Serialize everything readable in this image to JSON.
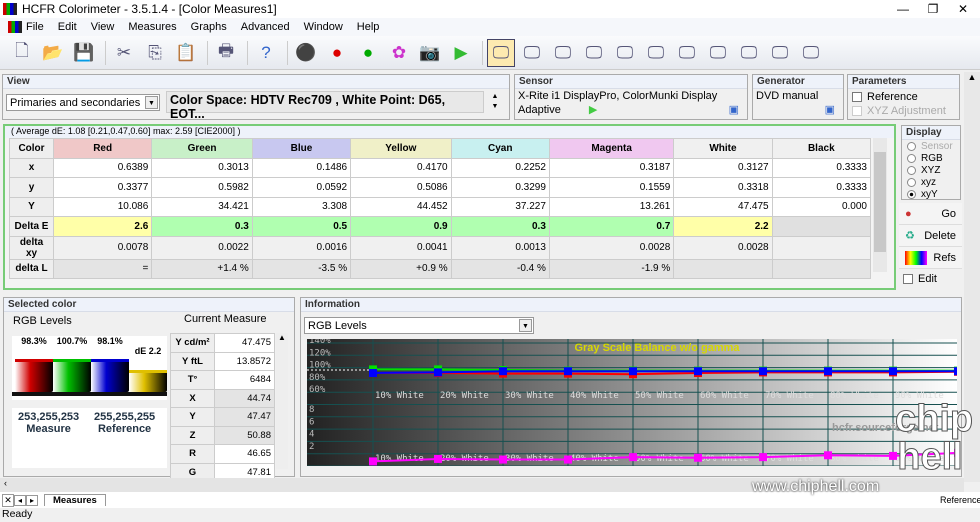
{
  "window": {
    "title": "HCFR Colorimeter - 3.5.1.4 - [Color Measures1]"
  },
  "menu": [
    "File",
    "Edit",
    "View",
    "Measures",
    "Graphs",
    "Advanced",
    "Window",
    "Help"
  ],
  "toolbar": [
    "new-icon",
    "open-icon",
    "save-icon",
    "cut-icon",
    "copy-icon",
    "paste-icon",
    "print-icon",
    "help-icon",
    "gray-scale-icon",
    "primaries-icon",
    "secondaries-icon",
    "saturation-icon",
    "camera-icon",
    "play-icon",
    "measures-view-icon",
    "graph-1-icon",
    "graph-2-icon",
    "graph-3-icon",
    "graph-4-icon",
    "graph-5-icon",
    "graph-6-icon",
    "graph-7-icon",
    "graph-8-icon",
    "graph-9-icon",
    "graph-10-icon"
  ],
  "view": {
    "label": "View",
    "mode": "Primaries and secondaries",
    "colorspace": "Color Space: HDTV Rec709 , White Point: D65, EOT..."
  },
  "sensor": {
    "label": "Sensor",
    "name": "X-Rite i1 DisplayPro, ColorMunki Display",
    "mode": "Adaptive"
  },
  "generator": {
    "label": "Generator",
    "name": "DVD manual"
  },
  "parameters": {
    "label": "Parameters",
    "reference": "Reference",
    "xyz_adjustment": "XYZ Adjustment"
  },
  "table": {
    "summary": "( Average dE: 1.08 [0.21,0.47,0.60] max: 2.59 [CIE2000] )",
    "corner": "Color",
    "columns": [
      {
        "name": "Red",
        "color": "#f0c8c8"
      },
      {
        "name": "Green",
        "color": "#c8f0c8"
      },
      {
        "name": "Blue",
        "color": "#c8c8f0"
      },
      {
        "name": "Yellow",
        "color": "#f0f0c8"
      },
      {
        "name": "Cyan",
        "color": "#c8f0f0"
      },
      {
        "name": "Magenta",
        "color": "#f0c8f0"
      },
      {
        "name": "White",
        "color": "#f0f0f0"
      },
      {
        "name": "Black",
        "color": "#f0f0f0"
      }
    ],
    "rows": [
      {
        "label": "x",
        "values": [
          "0.6389",
          "0.3013",
          "0.1486",
          "0.4170",
          "0.2252",
          "0.3187",
          "0.3127",
          "0.3333"
        ]
      },
      {
        "label": "y",
        "values": [
          "0.3377",
          "0.5982",
          "0.0592",
          "0.5086",
          "0.3299",
          "0.1559",
          "0.3318",
          "0.3333"
        ]
      },
      {
        "label": "Y",
        "values": [
          "10.086",
          "34.421",
          "3.308",
          "44.452",
          "37.227",
          "13.261",
          "47.475",
          "0.000"
        ]
      },
      {
        "label": "Delta E",
        "values": [
          "2.6",
          "0.3",
          "0.5",
          "0.9",
          "0.3",
          "0.7",
          "2.2",
          ""
        ]
      },
      {
        "label": "delta xy",
        "values": [
          "0.0078",
          "0.0022",
          "0.0016",
          "0.0041",
          "0.0013",
          "0.0028",
          "0.0028",
          ""
        ]
      },
      {
        "label": "delta L",
        "values": [
          "=",
          "+1.4 %",
          "-3.5 %",
          "+0.9 %",
          "-0.4 %",
          "-1.9 %",
          "",
          ""
        ]
      }
    ],
    "delta_e_colors": [
      "#ffffa8",
      "#b0ffb0",
      "#b0ffb0",
      "#b0ffb0",
      "#b0ffb0",
      "#b0ffb0",
      "#ffffa8",
      "#e0e0e0"
    ]
  },
  "display": {
    "label": "Display",
    "options": [
      {
        "label": "Sensor",
        "disabled": true
      },
      {
        "label": "RGB"
      },
      {
        "label": "XYZ"
      },
      {
        "label": "xyz"
      },
      {
        "label": "xyY",
        "selected": true
      }
    ]
  },
  "actions": {
    "go": "Go",
    "delete": "Delete",
    "refs": "Refs",
    "edit": "Edit"
  },
  "selected": {
    "label": "Selected color",
    "rgb_levels": "RGB Levels",
    "bars": [
      {
        "label": "98.3%",
        "color": "#d00000"
      },
      {
        "label": "100.7%",
        "color": "#00c000"
      },
      {
        "label": "98.1%",
        "color": "#0000d0"
      },
      {
        "label": "dE 2.2",
        "color": "#e0c000"
      }
    ],
    "measure_value": "253,255,253",
    "measure_label": "Measure",
    "reference_value": "255,255,255",
    "reference_label": "Reference",
    "current_measure": "Current Measure",
    "measures": [
      [
        "Y cd/m²",
        "47.475"
      ],
      [
        "Y ftL",
        "13.8572"
      ],
      [
        "T°",
        "6484"
      ],
      [
        "X",
        "44.74"
      ],
      [
        "Y",
        "47.47"
      ],
      [
        "Z",
        "50.88"
      ],
      [
        "R",
        "46.65"
      ],
      [
        "G",
        "47.81"
      ]
    ]
  },
  "information": {
    "label": "Information",
    "selection": "RGB Levels",
    "graph": {
      "title": "Gray Scale Balance w/o gamma",
      "watermark": "hcfr.sourceforge.net",
      "y_ticks_top": [
        "140%",
        "120%",
        "100%",
        "80%",
        "60%"
      ],
      "y_ticks_bottom": [
        "8",
        "6",
        "4",
        "2"
      ],
      "categories": [
        "10% White",
        "20% White",
        "30% White",
        "40% White",
        "50% White",
        "60% White",
        "70% White",
        "80% White",
        "90% White"
      ],
      "x": [
        10,
        20,
        30,
        40,
        50,
        60,
        70,
        80,
        90,
        100
      ],
      "series": [
        {
          "color": "#00e000",
          "values": [
            101,
            101,
            100,
            99,
            99,
            99,
            99,
            99,
            99,
            99
          ]
        },
        {
          "color": "#ff0000",
          "values": [
            95,
            95,
            94,
            94,
            93,
            95,
            96,
            96,
            96,
            97
          ]
        },
        {
          "color": "#0000ff",
          "values": [
            95,
            96,
            98,
            98,
            98,
            98,
            98,
            98,
            98,
            98
          ]
        }
      ],
      "de_series": {
        "color": "#ff00ff",
        "values": [
          0.1,
          0.5,
          0.4,
          0.4,
          0.8,
          0.7,
          0.8,
          1.1,
          1.0,
          1.5
        ]
      }
    }
  },
  "tabs": [
    "Measures"
  ],
  "status": {
    "text": "Ready",
    "reference": "Reference"
  },
  "overlay": {
    "site": "www.chiphell.com",
    "logo": "chip hell"
  }
}
